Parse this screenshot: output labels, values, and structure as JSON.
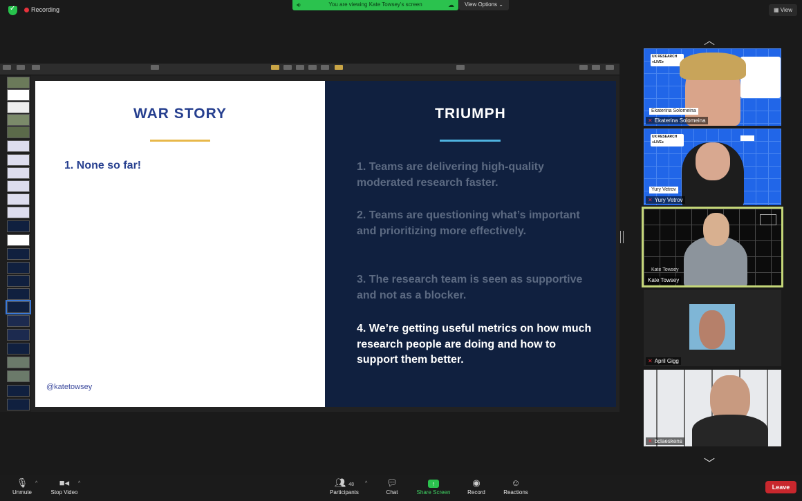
{
  "meeting": {
    "recording_label": "Recording",
    "banner_text": "You are viewing Kate Towsey's screen",
    "view_options_label": "View Options ⌄",
    "view_label": "View"
  },
  "slide": {
    "left": {
      "title": "WAR STORY",
      "item": "1. None so far!",
      "handle": "@katetowsey"
    },
    "right": {
      "title": "TRIUMPH",
      "items": [
        "1. Teams are delivering high-quality moderated research faster.",
        "2. Teams are questioning what’s important and prioritizing more effectively.",
        "3. The research team is seen as supportive and not as a blocker.",
        "4. We’re getting useful metrics on how much research people are doing and how to support them better."
      ]
    }
  },
  "participants": [
    {
      "name": "Ekaterina Solomeina",
      "onscreen": "Ekaterina Solomeina"
    },
    {
      "name": "Yury Vetrov",
      "onscreen": "Yury Vetrov"
    },
    {
      "name": "Kate Towsey",
      "onscreen": "Kate Towsey"
    },
    {
      "name": "April Gigg"
    },
    {
      "name": "bclaeskens"
    }
  ],
  "ux_logo": "UX RESEARCH ●LIVE●",
  "toolbar": {
    "unmute": "Unmute",
    "stop_video": "Stop Video",
    "participants": "Participants",
    "participants_count": "48",
    "chat": "Chat",
    "share_screen": "Share Screen",
    "record": "Record",
    "reactions": "Reactions",
    "leave": "Leave"
  },
  "colors": {
    "accent_green": "#2bc24e",
    "leave_red": "#c8272d",
    "slide_navy": "#10203f",
    "title_blue": "#263f8f"
  }
}
